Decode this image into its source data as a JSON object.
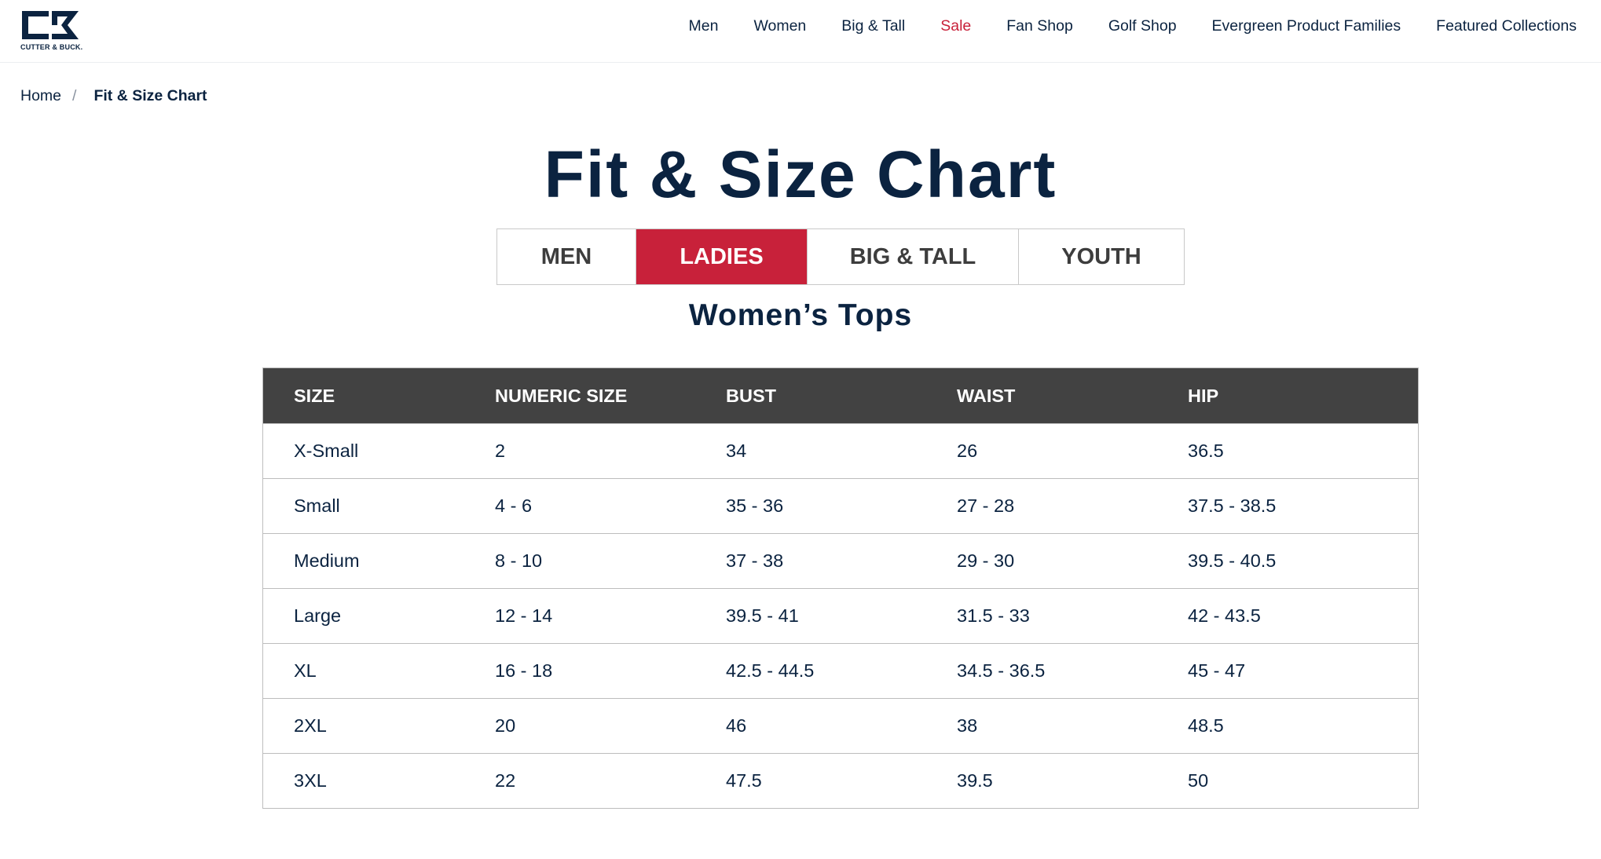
{
  "brand": {
    "logo_text": "CUTTER & BUCK."
  },
  "nav": {
    "items": [
      "Men",
      "Women",
      "Big & Tall",
      "Sale",
      "Fan Shop",
      "Golf Shop",
      "Evergreen Product Families",
      "Featured Collections"
    ]
  },
  "breadcrumb": {
    "home": "Home",
    "separator": "/",
    "current": "Fit & Size Chart"
  },
  "page": {
    "title": "Fit & Size Chart",
    "section_title": "Women’s Tops"
  },
  "tabs": [
    {
      "label": "MEN",
      "active": false
    },
    {
      "label": "LADIES",
      "active": true
    },
    {
      "label": "BIG & TALL",
      "active": false
    },
    {
      "label": "YOUTH",
      "active": false
    }
  ],
  "table": {
    "headers": [
      "SIZE",
      "NUMERIC SIZE",
      "BUST",
      "WAIST",
      "HIP"
    ],
    "rows": [
      [
        "X-Small",
        "2",
        "34",
        "26",
        "36.5"
      ],
      [
        "Small",
        "4 - 6",
        "35 - 36",
        "27 - 28",
        "37.5 - 38.5"
      ],
      [
        "Medium",
        "8 - 10",
        "37 - 38",
        "29 - 30",
        "39.5 - 40.5"
      ],
      [
        "Large",
        "12 - 14",
        "39.5 - 41",
        "31.5 - 33",
        "42 - 43.5"
      ],
      [
        "XL",
        "16 - 18",
        "42.5 - 44.5",
        "34.5 - 36.5",
        "45 - 47"
      ],
      [
        "2XL",
        "20",
        "46",
        "38",
        "48.5"
      ],
      [
        "3XL",
        "22",
        "47.5",
        "39.5",
        "50"
      ]
    ]
  },
  "colors": {
    "navy": "#0b2340",
    "accent_red": "#c8213a",
    "table_header_bg": "#424242"
  }
}
